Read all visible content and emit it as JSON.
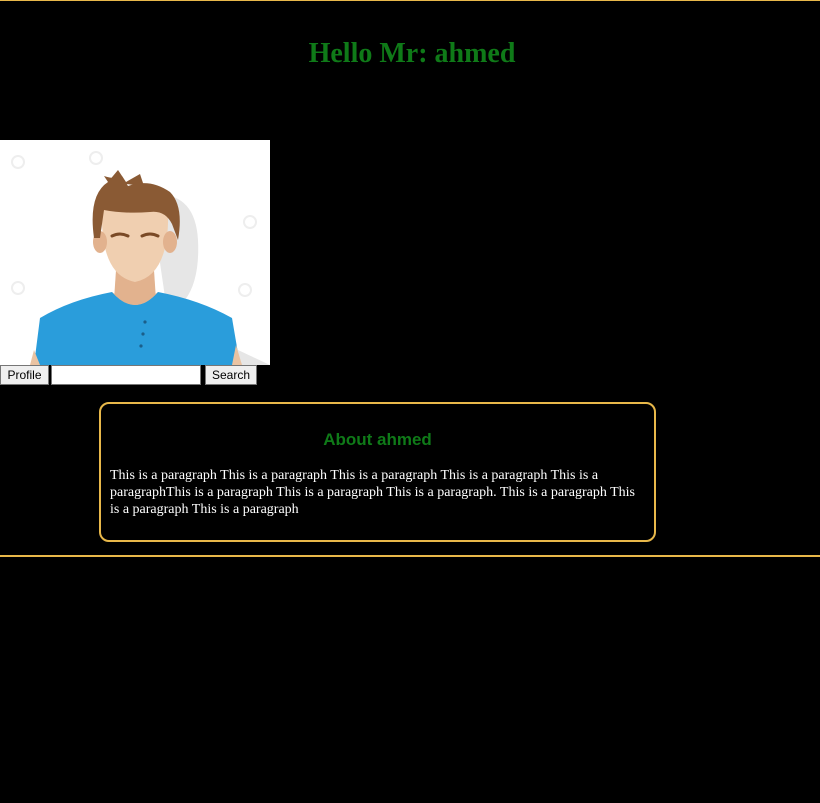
{
  "header": {
    "greeting": "Hello Mr: ahmed"
  },
  "profile": {
    "avatar_icon": "user-avatar-icon",
    "profile_button_label": "Profile",
    "search_value": "",
    "search_button_label": "Search"
  },
  "about": {
    "title": "About ahmed",
    "text": "This is a paragraph This is a paragraph This is a paragraph This is a paragraph This is a paragraphThis is a paragraph This is a paragraph This is a paragraph. This is a paragraph This is a paragraph This is a paragraph"
  },
  "colors": {
    "background": "#000000",
    "accent_border": "#e8b84a",
    "heading_green": "#0f7a18",
    "body_text": "#ffffff"
  }
}
